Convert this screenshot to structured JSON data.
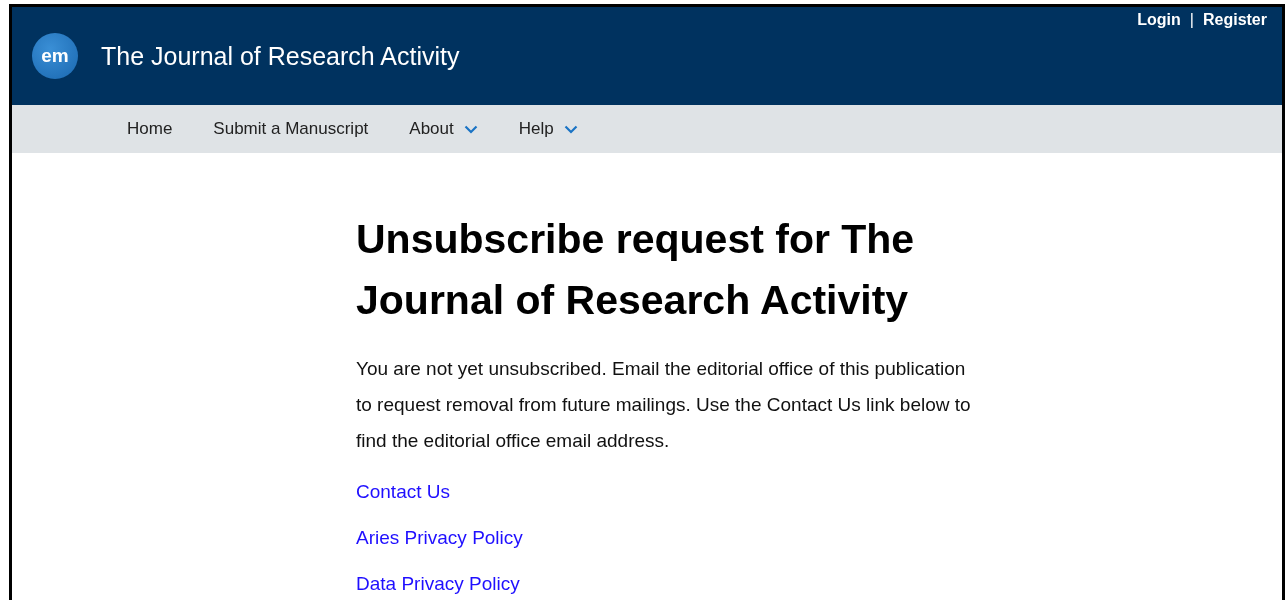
{
  "header": {
    "logo_text": "em",
    "title": "The Journal of Research Activity",
    "account_links": [
      {
        "label": "Login"
      },
      {
        "label": "Register"
      }
    ],
    "separator": "|"
  },
  "nav": [
    {
      "label": "Home",
      "has_menu": false
    },
    {
      "label": "Submit a Manuscript",
      "has_menu": false
    },
    {
      "label": "About",
      "has_menu": true
    },
    {
      "label": "Help",
      "has_menu": true
    }
  ],
  "content": {
    "heading": "Unsubscribe request for The Journal of Research Activity",
    "message": "You are not yet unsubscribed. Email the editorial office of this publication to request removal from future mailings. Use the Contact Us link below to find the editorial office email address.",
    "links": [
      {
        "label": "Contact Us"
      },
      {
        "label": "Aries Privacy Policy"
      },
      {
        "label": "Data Privacy Policy"
      }
    ]
  }
}
